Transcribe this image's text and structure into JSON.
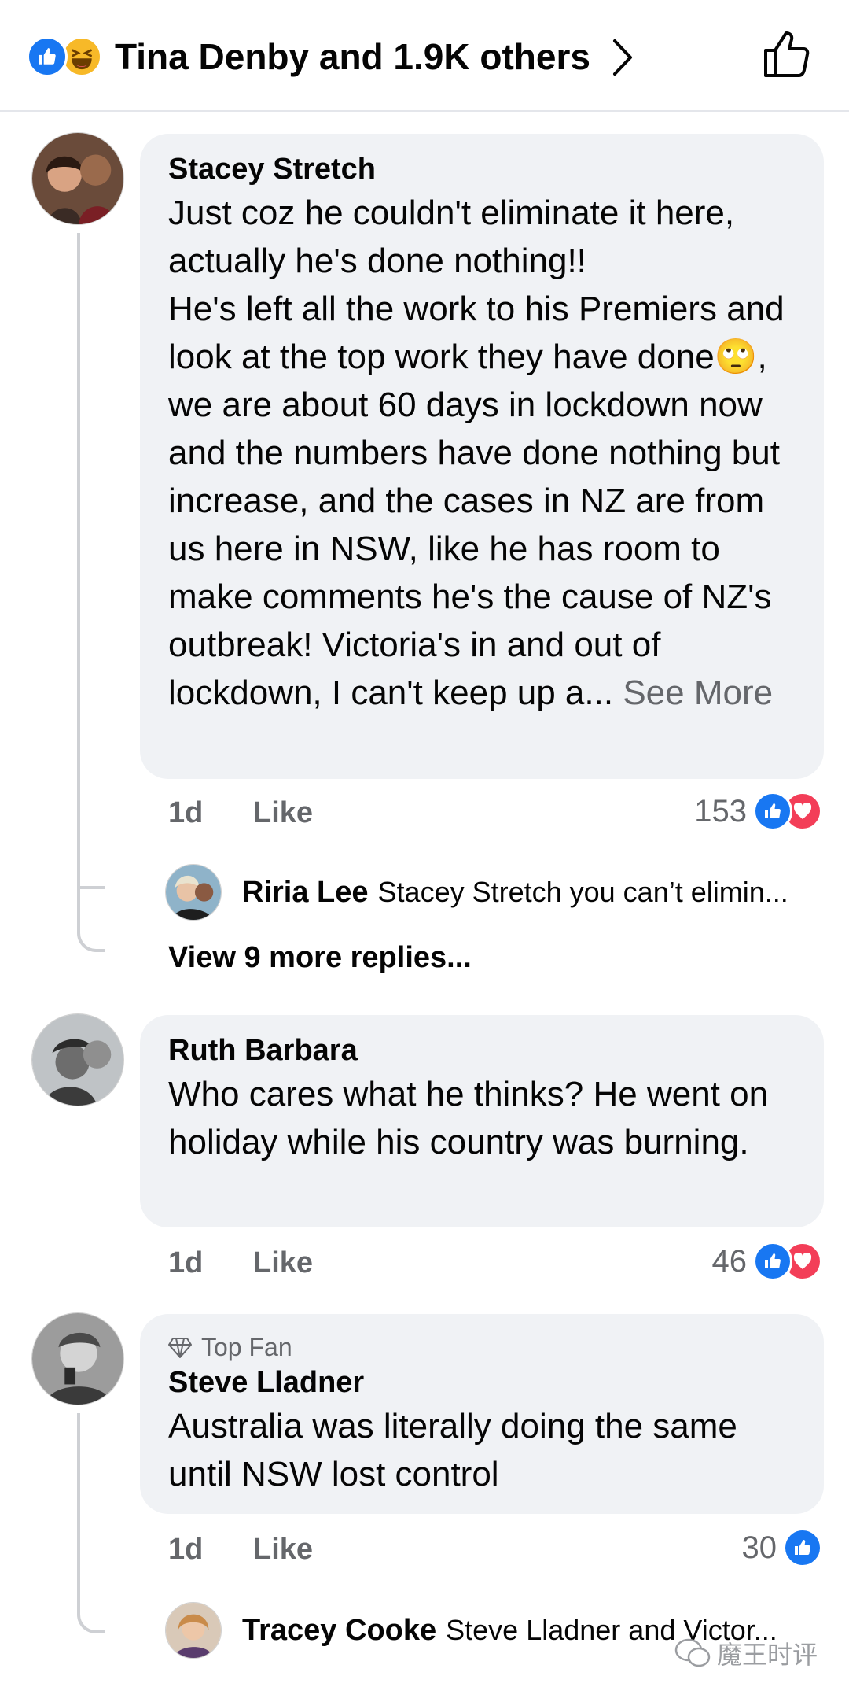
{
  "header": {
    "liker_summary": "Tina Denby and 1.9K others",
    "reactions": [
      "like-icon",
      "haha-icon"
    ]
  },
  "comments": [
    {
      "author": "Stacey Stretch",
      "text": "Just coz he couldn't eliminate it here, actually he's done nothing!!\nHe's left all the work to his Premiers and look at the top work they have done🙄, we are about 60 days in lockdown now and the numbers have done nothing but increase, and the cases in NZ are from us here in NSW, like he has room to make comments he's the cause of NZ's outbreak! Victoria's in and out of lockdown, I can't keep up a...",
      "see_more": "See More",
      "time": "1d",
      "like_label": "Like",
      "reaction_count": "153",
      "reply": {
        "author": "Riria Lee",
        "text": "Stacey Stretch you can’t elimin..."
      },
      "view_more": "View 9 more replies..."
    },
    {
      "author": "Ruth Barbara",
      "text": "Who cares what he thinks? He went on holiday while his country was burning.",
      "time": "1d",
      "like_label": "Like",
      "reaction_count": "46"
    },
    {
      "badge": "Top Fan",
      "author": "Steve Lladner",
      "text": "Australia was literally doing the same until NSW lost control",
      "time": "1d",
      "like_label": "Like",
      "reaction_count": "30",
      "reply": {
        "author": "Tracey Cooke",
        "text": "Steve Lladner  and Victor..."
      }
    }
  ],
  "watermark": "魔王时评",
  "colors": {
    "like_blue": "#1877f2",
    "love_red": "#f33e58",
    "haha_yellow": "#f7b928",
    "bubble_bg": "#f0f2f5",
    "secondary_text": "#65676b"
  }
}
